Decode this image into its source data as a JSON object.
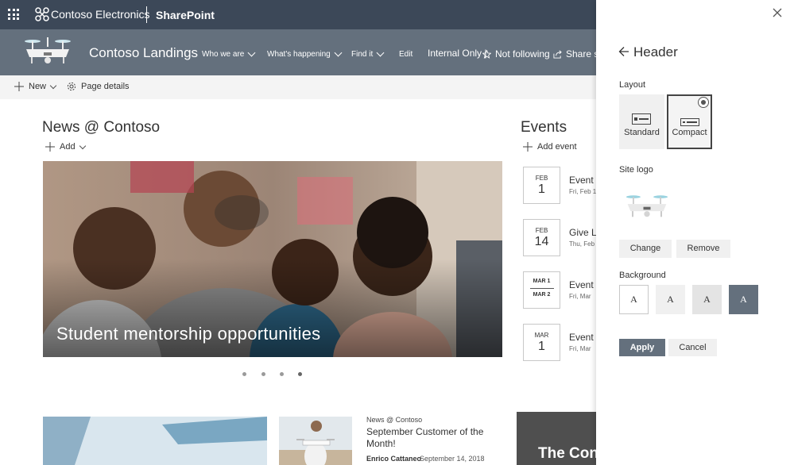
{
  "suite": {
    "brand": "Contoso Electronics",
    "app": "SharePoint"
  },
  "site": {
    "title": "Contoso Landings",
    "nav": [
      {
        "label": "Who we are",
        "has_chevron": true
      },
      {
        "label": "What's happening",
        "has_chevron": true
      },
      {
        "label": "Find it",
        "has_chevron": true
      },
      {
        "label": "Edit",
        "has_chevron": false
      }
    ],
    "internal_label": "Internal Only |",
    "follow_label": "Not following",
    "share_label": "Share site"
  },
  "commandbar": {
    "new_label": "New",
    "page_details_label": "Page details"
  },
  "news": {
    "title": "News @ Contoso",
    "add_label": "Add",
    "hero_caption": "Student mentorship opportunities",
    "carousel_dots": 4
  },
  "events": {
    "title": "Events",
    "add_label": "Add event",
    "items": [
      {
        "month": "FEB",
        "day": "1",
        "title": "Event t",
        "sub": "Fri, Feb 1"
      },
      {
        "month": "FEB",
        "day": "14",
        "title": "Give LC",
        "sub": "Thu, Feb"
      },
      {
        "month": "MAR 1",
        "day": "MAR 2",
        "title": "Event t",
        "sub": "Fri, Mar"
      },
      {
        "month": "MAR",
        "day": "1",
        "title": "Event t",
        "sub": "Fri, Mar"
      }
    ]
  },
  "news_cards": {
    "card2_source": "News @ Contoso",
    "card2_title": "September Customer of the Month!",
    "card2_author": "Enrico Cattaneo",
    "card2_date": "September 14, 2018"
  },
  "promo": {
    "text": "The Cont"
  },
  "panel": {
    "title": "Header",
    "layout_label": "Layout",
    "layout_options": [
      "Standard",
      "Compact"
    ],
    "selected_layout": "Compact",
    "site_logo_label": "Site logo",
    "change_label": "Change",
    "remove_label": "Remove",
    "background_label": "Background",
    "background_swatches": [
      {
        "glyph": "A",
        "color": "#ffffff",
        "border": "#c8c8c8",
        "text": "#333333"
      },
      {
        "glyph": "A",
        "color": "#f0f0f0",
        "border": "#f0f0f0",
        "text": "#333333"
      },
      {
        "glyph": "A",
        "color": "#e4e4e4",
        "border": "#e4e4e4",
        "text": "#333333"
      },
      {
        "glyph": "A",
        "color": "#64707d",
        "border": "#64707d",
        "text": "#ffffff"
      }
    ],
    "apply_label": "Apply",
    "cancel_label": "Cancel"
  },
  "colors": {
    "suite_bar": "#3c4858",
    "site_header": "#64707d",
    "accent": "#64707d"
  }
}
